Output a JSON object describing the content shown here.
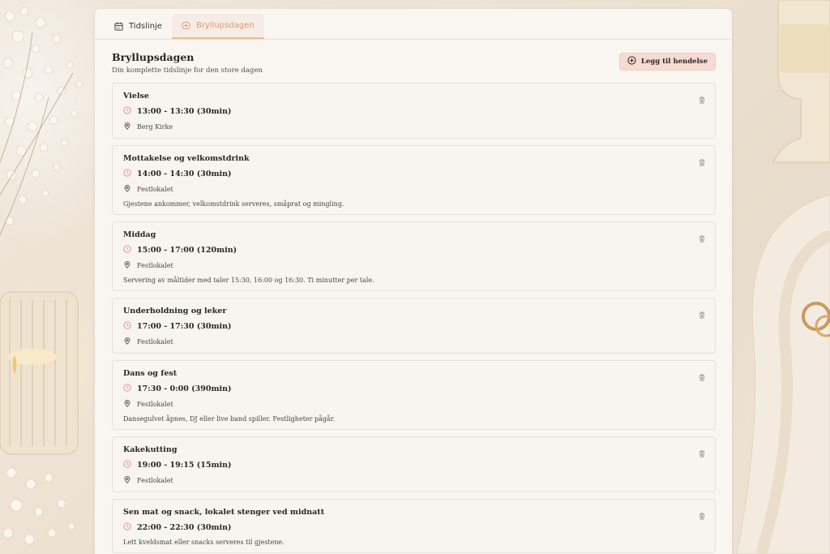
{
  "tabs": [
    {
      "label": "Tidslinje",
      "icon": "calendar-icon",
      "active": false
    },
    {
      "label": "Bryllupsdagen",
      "icon": "plus-circle-icon",
      "active": true
    }
  ],
  "page": {
    "title": "Bryllupsdagen",
    "subtitle": "Din komplette tidslinje for den store dagen",
    "add_button_label": "Legg til hendelse"
  },
  "events": [
    {
      "title": "Vielse",
      "time": "13:00 - 13:30 (30min)",
      "location": "Berg Kirke",
      "description": ""
    },
    {
      "title": "Mottakelse og velkomstdrink",
      "time": "14:00 - 14:30 (30min)",
      "location": "Festlokalet",
      "description": "Gjestene ankommer, velkomstdrink serveres, småprat og mingling."
    },
    {
      "title": "Middag",
      "time": "15:00 - 17:00 (120min)",
      "location": "Festlokalet",
      "description": "Servering av måltider med taler 15:30, 16:00 og 16:30. Ti minutter per tale."
    },
    {
      "title": "Underholdning og leker",
      "time": "17:00 - 17:30 (30min)",
      "location": "Festlokalet",
      "description": ""
    },
    {
      "title": "Dans og fest",
      "time": "17:30 - 0:00 (390min)",
      "location": "Festlokalet",
      "description": "Dansegulvet åpnes, DJ eller live band spiller. Festligheter pågår."
    },
    {
      "title": "Kakekutting",
      "time": "19:00 - 19:15 (15min)",
      "location": "Festlokalet",
      "description": ""
    },
    {
      "title": "Sen mat og snack, lokalet stenger ved midnatt",
      "time": "22:00 - 22:30 (30min)",
      "location": "",
      "description": "Lett kveldsmat eller snacks serveres til gjestene."
    }
  ],
  "colors": {
    "accent": "#e0996a",
    "clock_icon": "#e58d7c",
    "button_bg": "#f7dbd2"
  }
}
